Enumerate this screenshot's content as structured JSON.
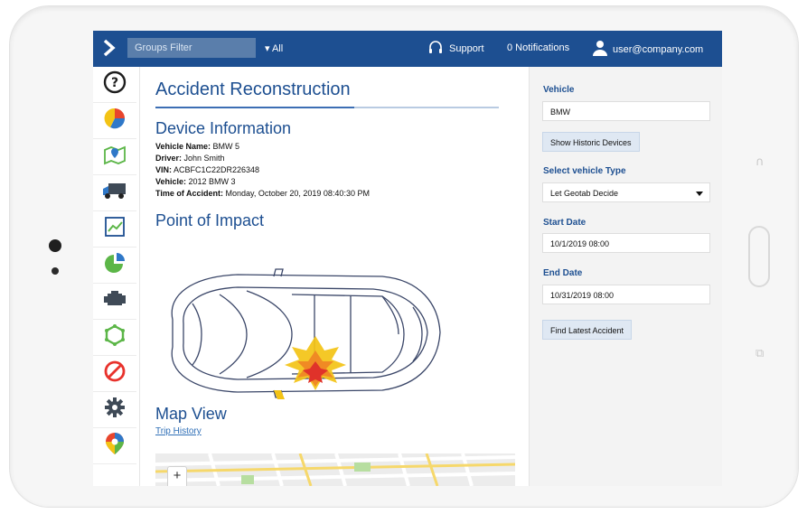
{
  "topbar": {
    "groups_filter_label": "Groups Filter",
    "groups_value": "▾ All",
    "support_label": "Support",
    "notifications_label": "0 Notifications",
    "user_email": "user@company.com"
  },
  "main": {
    "title": "Accident Reconstruction",
    "device_info_heading": "Device Information",
    "device_info": [
      {
        "label": "Vehicle Name:",
        "value": " BMW 5"
      },
      {
        "label": "Driver:",
        "value": " John Smith"
      },
      {
        "label": "VIN:",
        "value": " ACBFC1C22DR226348"
      },
      {
        "label": "Vehicle:",
        "value": " 2012 BMW 3"
      },
      {
        "label": "Time of Accident:",
        "value": " Monday, October 20, 2019 08:40:30 PM"
      }
    ],
    "impact_heading": "Point of Impact",
    "map_heading": "Map View",
    "trip_history_link": "Trip History",
    "zoom_in": "+",
    "zoom_out": "−"
  },
  "panel": {
    "vehicle_label": "Vehicle",
    "vehicle_value": "BMW",
    "historic_button": "Show Historic Devices",
    "type_label": "Select vehicle Type",
    "type_value": "Let Geotab Decide",
    "start_label": "Start Date",
    "start_value": "10/1/2019 08:00",
    "end_label": "End Date",
    "end_value": "10/31/2019 08:00",
    "find_button": "Find Latest Accident"
  },
  "sidebar": {
    "icons": [
      "help-icon",
      "pie-chart-icon",
      "map-pin-icon",
      "truck-icon",
      "activity-chart-icon",
      "pie-pin-icon",
      "engine-icon",
      "zone-icon",
      "block-icon",
      "gear-icon",
      "marketplace-icon"
    ]
  },
  "colors": {
    "brand_blue": "#1d4f91",
    "panel_bg": "#f3f3f3",
    "link_blue": "#2f6fb7"
  }
}
